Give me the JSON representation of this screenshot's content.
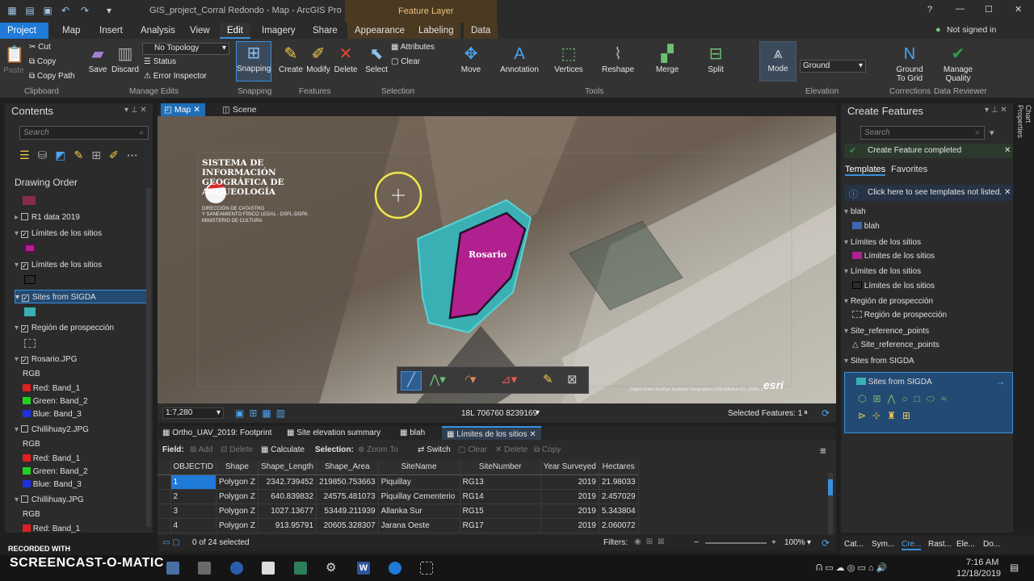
{
  "titlebar": {
    "title": "GIS_project_Corral Redondo - Map - ArcGIS Pro",
    "context": "Feature Layer",
    "help": "?",
    "minimize": "—",
    "maximize": "☐",
    "close": "✕",
    "signin": "Not signed in"
  },
  "tabs": [
    "Project",
    "Map",
    "Insert",
    "Analysis",
    "View",
    "Edit",
    "Imagery",
    "Share",
    "Appearance",
    "Labeling",
    "Data"
  ],
  "ribbon": {
    "clipboard": {
      "cut": "Cut",
      "copy": "Copy",
      "copy_path": "Copy Path",
      "paste": "Paste",
      "group": "Clipboard"
    },
    "manage": {
      "save": "Save",
      "discard": "Discard",
      "topology": "No Topology",
      "status": "Status",
      "error": "Error Inspector",
      "group": "Manage Edits"
    },
    "snapping": {
      "label": "Snapping",
      "group": "Snapping"
    },
    "features": {
      "create": "Create",
      "modify": "Modify",
      "delete": "Delete",
      "group": "Features"
    },
    "selection": {
      "select": "Select",
      "attributes": "Attributes",
      "clear": "Clear",
      "group": "Selection"
    },
    "tools": {
      "move": "Move",
      "annotation": "Annotation",
      "vertices": "Vertices",
      "reshape": "Reshape",
      "merge": "Merge",
      "split": "Split",
      "group": "Tools"
    },
    "elevation": {
      "mode": "Mode",
      "ground": "Ground",
      "group": "Elevation"
    },
    "corrections": {
      "ground_to_grid": "Ground To Grid",
      "group": "Corrections"
    },
    "reviewer": {
      "manage_quality": "Manage Quality",
      "group": "Data Reviewer"
    }
  },
  "contents": {
    "title": "Contents",
    "search_placeholder": "Search",
    "drawing_order": "Drawing Order",
    "items": [
      {
        "label": "R1 data 2019",
        "checked": false
      },
      {
        "label": "Límites de los sitios",
        "checked": true
      },
      {
        "label": "Límites de los sitios",
        "checked": true
      },
      {
        "label": "Sites from SIGDA",
        "checked": true
      },
      {
        "label": "Región de prospección",
        "checked": true
      },
      {
        "label": "Rosario.JPG",
        "checked": true
      },
      {
        "label": "Chillihuay2.JPG",
        "checked": false
      },
      {
        "label": "Chillihuay.JPG",
        "checked": false
      }
    ],
    "rgb": "RGB",
    "red": "Red:",
    "green": "Green:",
    "blue": "Blue:",
    "band1": "Band_1",
    "band2": "Band_2",
    "band3": "Band_3"
  },
  "map": {
    "tab_map": "Map",
    "tab_scene": "Scene",
    "overlay_title": "SISTEMA DE INFORMACIÓN GEOGRÁFICA DE ARQUEOLOGÍA",
    "overlay_sub1": "DIRECCIÓN DE CATASTRO",
    "overlay_sub2": "Y SANEAMIENTO FÍSICO LEGAL - DSFL-DGPA",
    "overlay_sub3": "MINISTERIO DE CULTURA",
    "polygon_label": "Rosario",
    "scale": "1:7,280",
    "coords": "18L 706760 8239169",
    "selected": "Selected Features: 1",
    "esri": "esri",
    "credit": "Digital Globe, GeoEye, Earthstar Geographics, CNES/Airbus DS, USDA, USGS, AeroGRID, IGN, GIS User Community"
  },
  "createf": {
    "title": "Create Features",
    "search_placeholder": "Search",
    "completed": "Create Feature completed",
    "tab_templates": "Templates",
    "tab_favorites": "Favorites",
    "info": "Click here to see templates not listed.",
    "groups": [
      {
        "name": "blah",
        "item": "blah"
      },
      {
        "name": "Límites de los sitios",
        "item": "Límites de los sitios"
      },
      {
        "name": "Límites de los sitios",
        "item": "Límites de los sitios"
      },
      {
        "name": "Región de prospección",
        "item": "Región de prospección"
      },
      {
        "name": "Site_reference_points",
        "item": "Site_reference_points"
      },
      {
        "name": "Sites from SIGDA",
        "item": "Sites from SIGDA"
      }
    ]
  },
  "bottomtabs": [
    "Ortho_UAV_2019: Footprint",
    "Site elevation summary",
    "blah",
    "Límites de los sitios"
  ],
  "attr": {
    "field": "Field:",
    "add": "Add",
    "delete": "Delete",
    "calculate": "Calculate",
    "selection": "Selection:",
    "zoom_to": "Zoom To",
    "switch": "Switch",
    "clear": "Clear",
    "sel_delete": "Delete",
    "copy": "Copy",
    "columns": [
      "OBJECTID",
      "Shape",
      "Shape_Length",
      "Shape_Area",
      "SiteName",
      "SiteNumber",
      "Year Surveyed",
      "Hectares"
    ],
    "rows": [
      [
        "1",
        "Polygon Z",
        "2342.739452",
        "219850.753663",
        "Piquillay",
        "RG13",
        "2019",
        "21.98033"
      ],
      [
        "2",
        "Polygon Z",
        "640.839832",
        "24575.481073",
        "Piquillay Cementerio",
        "RG14",
        "2019",
        "2.457029"
      ],
      [
        "3",
        "Polygon Z",
        "1027.13677",
        "53449.211939",
        "Allanka Sur",
        "RG15",
        "2019",
        "5.343804"
      ],
      [
        "4",
        "Polygon Z",
        "913.95791",
        "20605.328307",
        "Jarana Oeste",
        "RG17",
        "2019",
        "2.060072"
      ]
    ],
    "selected_count": "0 of 24 selected",
    "filters": "Filters:",
    "zoom": "100%"
  },
  "rightdock": [
    "Cat...",
    "Sym...",
    "Cre...",
    "Rast...",
    "Ele...",
    "Do..."
  ],
  "sidetabs": [
    "Chart Properties"
  ],
  "taskbar": {
    "recorded_with": "RECORDED WITH",
    "brand": "SCREENCAST-O-MATIC",
    "time": "7:16 AM",
    "date": "12/18/2019"
  },
  "colors": {
    "accent": "#1f7ad8",
    "magenta": "#b0208f",
    "cyan": "#3ab0b4",
    "success": "#2e9d4c"
  }
}
